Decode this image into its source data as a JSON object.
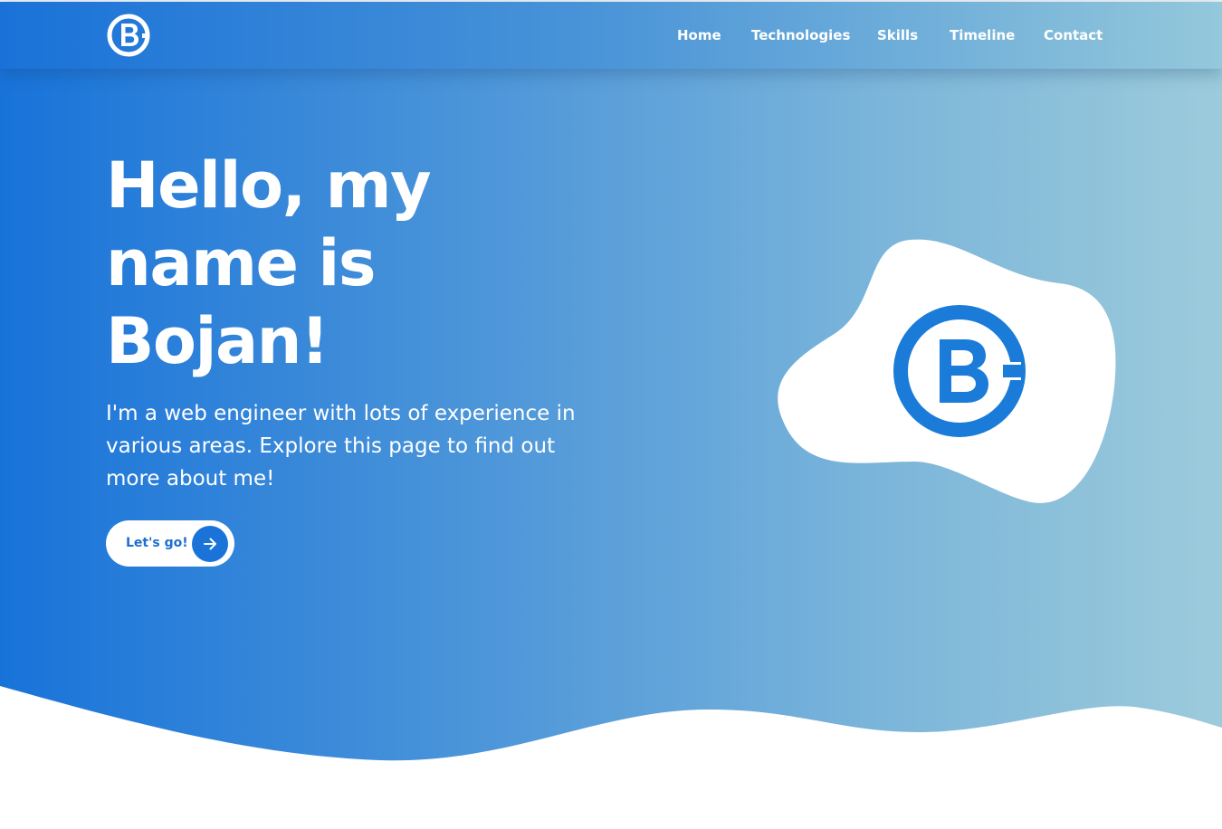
{
  "nav": {
    "logo_icon": "bc-monogram-logo",
    "links": [
      "Home",
      "Technologies",
      "Skills",
      "Timeline",
      "Contact"
    ]
  },
  "hero": {
    "title_lines": [
      "Hello, my",
      "name is",
      "Bojan!"
    ],
    "subtitle_lines": [
      "I'm a web engineer with lots of experience in",
      "various areas. Explore this page to find out",
      "more about me!"
    ],
    "cta_label": "Let's go!",
    "cta_icon": "arrow-right-icon",
    "illustration": "bc-monogram-logo on white blob"
  },
  "colors": {
    "accent": "#1a73d9",
    "gradient_start": "#1873d9",
    "gradient_end": "#9ccbdb",
    "text": "#ffffff"
  }
}
